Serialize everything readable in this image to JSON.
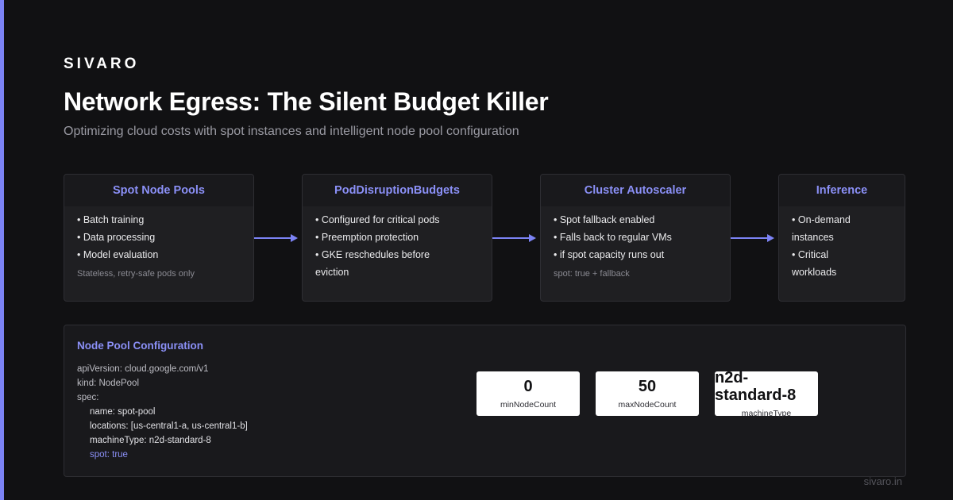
{
  "brand": "SIVARO",
  "title": "Network Egress: The Silent Budget Killer",
  "subtitle": "Optimizing cloud costs with spot instances and intelligent node pool configuration",
  "colors": {
    "accent": "#7c83f5",
    "background": "#111113",
    "card": "#1f1f22",
    "card_title": "#8b90f7"
  },
  "cards": [
    {
      "title": "Spot Node Pools",
      "items": [
        "• Batch training",
        "• Data processing",
        "• Model evaluation"
      ],
      "note": "Stateless, retry-safe pods only"
    },
    {
      "title": "PodDisruptionBudgets",
      "items": [
        "• Configured for critical pods",
        "• Preemption protection",
        "• GKE reschedules before",
        "eviction"
      ],
      "note": ""
    },
    {
      "title": "Cluster Autoscaler",
      "items": [
        "• Spot fallback enabled",
        "• Falls back to regular VMs",
        "• if spot capacity runs out"
      ],
      "note": "spot: true + fallback"
    },
    {
      "title": "Inference",
      "items": [
        "• On-demand",
        "instances",
        "• Critical",
        "workloads"
      ],
      "note": ""
    }
  ],
  "config": {
    "title": "Node Pool Configuration",
    "code": {
      "api_version": "apiVersion: cloud.google.com/v1",
      "kind": "kind: NodePool",
      "spec": "spec:",
      "name": "name: spot-pool",
      "locations": "locations: [us-central1-a, us-central1-b]",
      "machine_type": "machineType: n2d-standard-8",
      "spot": "spot: true"
    },
    "stats": [
      {
        "value": "0",
        "label": "minNodeCount"
      },
      {
        "value": "50",
        "label": "maxNodeCount"
      },
      {
        "value": "n2d-standard-8",
        "label": "machineType"
      }
    ]
  },
  "footer": "sivaro.in"
}
